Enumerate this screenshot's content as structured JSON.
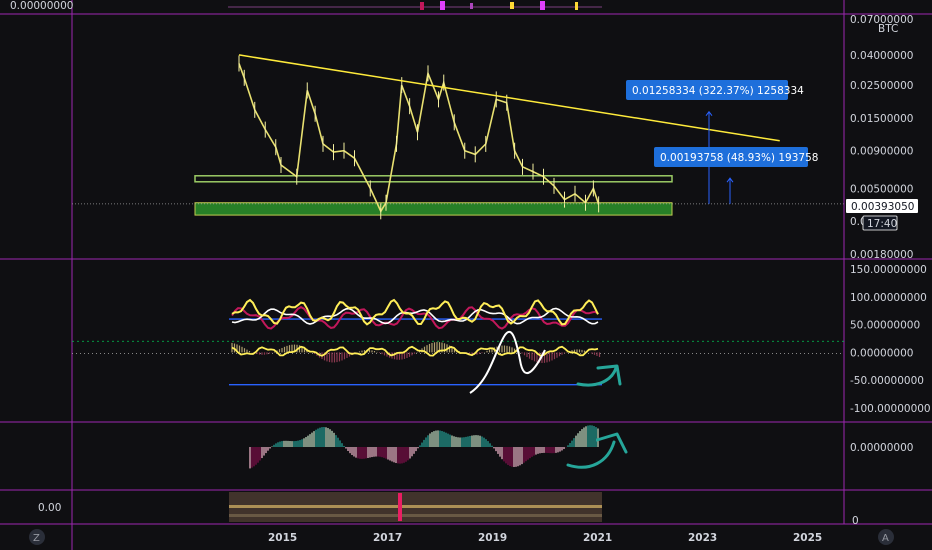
{
  "top_value": "0.00000000",
  "chart_data": {
    "type": "line",
    "title": "",
    "x_ticks": [
      "2015",
      "2017",
      "2019",
      "2021",
      "2023",
      "2025"
    ],
    "price_axis": {
      "unit": "BTC",
      "scale": "log",
      "ticks": [
        "0.07000000",
        "0.04000000",
        "0.02500000",
        "0.01500000",
        "0.00900000",
        "0.00500000",
        "0.003",
        "0.00180000"
      ]
    },
    "current_price": "0.00393050",
    "countdown": "17:40",
    "measurements": [
      {
        "text": "0.01258334 (322.37%) 1258334",
        "from": 0.0039305,
        "to": 0.01651384
      },
      {
        "text": "0.00193758 (48.93%) 193758",
        "from": 0.0039305,
        "to": 0.00586808
      }
    ],
    "trendline": {
      "from": [
        "2014.2",
        0.04
      ],
      "to": [
        "2024.5",
        0.0105
      ]
    },
    "zones": [
      {
        "kind": "support",
        "color": "#2a8c2a",
        "low": 0.0033,
        "high": 0.004,
        "x_from": "2013.3",
        "x_to": "2022.5"
      },
      {
        "kind": "resistance",
        "color": "#9ccc65",
        "low": 0.0056,
        "high": 0.0059,
        "x_from": "2013.3",
        "x_to": "2022.5"
      }
    ],
    "price_series": {
      "x": [
        2014.2,
        2014.3,
        2014.5,
        2014.7,
        2014.9,
        2015.0,
        2015.3,
        2015.5,
        2015.65,
        2015.8,
        2016.0,
        2016.2,
        2016.4,
        2016.7,
        2016.9,
        2017.0,
        2017.2,
        2017.3,
        2017.45,
        2017.6,
        2017.8,
        2018.0,
        2018.1,
        2018.3,
        2018.5,
        2018.7,
        2018.9,
        2019.1,
        2019.3,
        2019.45,
        2019.6,
        2019.8,
        2020.0,
        2020.2,
        2020.4,
        2020.6,
        2020.8,
        2020.95,
        2021.05
      ],
      "y": [
        0.035,
        0.028,
        0.017,
        0.0125,
        0.0095,
        0.0072,
        0.006,
        0.023,
        0.016,
        0.01,
        0.0088,
        0.009,
        0.008,
        0.005,
        0.0035,
        0.004,
        0.01,
        0.025,
        0.018,
        0.012,
        0.03,
        0.02,
        0.026,
        0.014,
        0.009,
        0.0085,
        0.01,
        0.02,
        0.019,
        0.009,
        0.007,
        0.0065,
        0.006,
        0.0052,
        0.0042,
        0.0046,
        0.004,
        0.005,
        0.0039
      ]
    },
    "oscillator_axis": {
      "ticks": [
        "150.00000000",
        "100.00000000",
        "50.00000000",
        "0.00000000",
        "-50.00000000",
        "-100.00000000"
      ]
    },
    "oscillator_levels": [
      {
        "value": 60,
        "color": "#2962ff"
      },
      {
        "value": -58,
        "color": "#2962ff"
      },
      {
        "value": 20,
        "color": "#00c853"
      }
    ],
    "histogram_axis": {
      "ticks": [
        "0.00000000"
      ]
    },
    "bottom_pane": {
      "left_value": "0.00",
      "ticks": [
        "0"
      ]
    }
  },
  "corner_buttons": {
    "left": "Z",
    "right": "A"
  },
  "colors": {
    "background": "#0f0f12",
    "separator": "#9c27b0",
    "trendline": "#ffeb3b",
    "label_bg": "#1e6fdb",
    "arrow": "#26a69a"
  }
}
